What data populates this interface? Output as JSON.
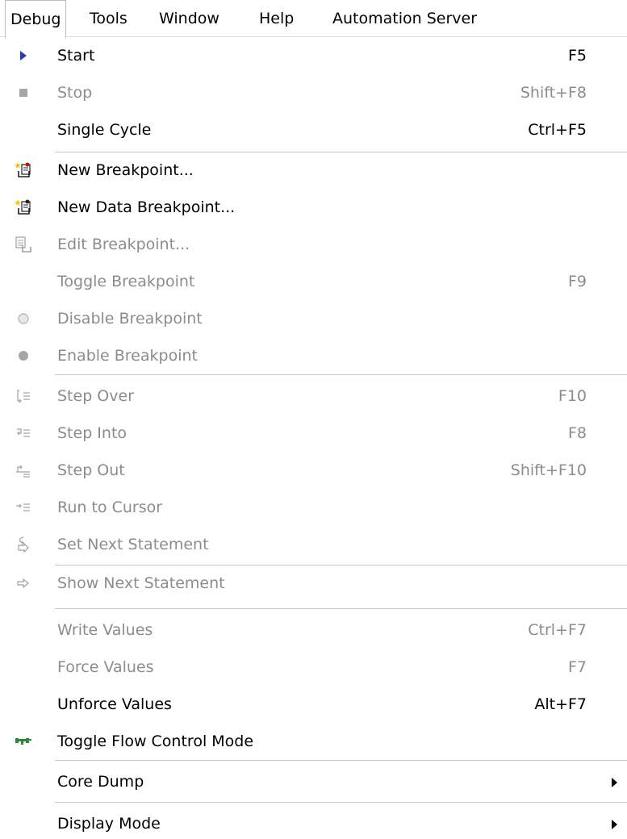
{
  "menubar": {
    "items": [
      "Debug",
      "Tools",
      "Window",
      "Help",
      "Automation Server"
    ]
  },
  "menu": {
    "items": [
      {
        "label": "Start",
        "shortcut": "F5",
        "enabled": true,
        "icon": "play-icon"
      },
      {
        "label": "Stop",
        "shortcut": "Shift+F8",
        "enabled": false,
        "icon": "stop-icon"
      },
      {
        "label": "Single Cycle",
        "shortcut": "Ctrl+F5",
        "enabled": true,
        "icon": ""
      },
      {
        "label": "New Breakpoint...",
        "shortcut": "",
        "enabled": true,
        "icon": "new-breakpoint-icon"
      },
      {
        "label": "New Data Breakpoint...",
        "shortcut": "",
        "enabled": true,
        "icon": "new-data-breakpoint-icon"
      },
      {
        "label": "Edit Breakpoint...",
        "shortcut": "",
        "enabled": false,
        "icon": "edit-breakpoint-icon"
      },
      {
        "label": "Toggle Breakpoint",
        "shortcut": "F9",
        "enabled": false,
        "icon": ""
      },
      {
        "label": "Disable Breakpoint",
        "shortcut": "",
        "enabled": false,
        "icon": "disable-breakpoint-icon"
      },
      {
        "label": "Enable Breakpoint",
        "shortcut": "",
        "enabled": false,
        "icon": "enable-breakpoint-icon"
      },
      {
        "label": "Step Over",
        "shortcut": "F10",
        "enabled": false,
        "icon": "step-over-icon"
      },
      {
        "label": "Step Into",
        "shortcut": "F8",
        "enabled": false,
        "icon": "step-into-icon"
      },
      {
        "label": "Step Out",
        "shortcut": "Shift+F10",
        "enabled": false,
        "icon": "step-out-icon"
      },
      {
        "label": "Run to Cursor",
        "shortcut": "",
        "enabled": false,
        "icon": "run-to-cursor-icon"
      },
      {
        "label": "Set Next Statement",
        "shortcut": "",
        "enabled": false,
        "icon": "set-next-statement-icon"
      },
      {
        "label": "Show Next Statement",
        "shortcut": "",
        "enabled": false,
        "icon": "show-next-statement-icon"
      },
      {
        "label": "Write Values",
        "shortcut": "Ctrl+F7",
        "enabled": false,
        "icon": ""
      },
      {
        "label": "Force Values",
        "shortcut": "F7",
        "enabled": false,
        "icon": ""
      },
      {
        "label": "Unforce Values",
        "shortcut": "Alt+F7",
        "enabled": true,
        "icon": ""
      },
      {
        "label": "Toggle Flow Control Mode",
        "shortcut": "",
        "enabled": true,
        "icon": "flow-control-icon"
      },
      {
        "label": "Core Dump",
        "shortcut": "",
        "enabled": true,
        "icon": "",
        "submenu": true
      },
      {
        "label": "Display Mode",
        "shortcut": "",
        "enabled": true,
        "icon": "",
        "submenu": true
      }
    ]
  }
}
